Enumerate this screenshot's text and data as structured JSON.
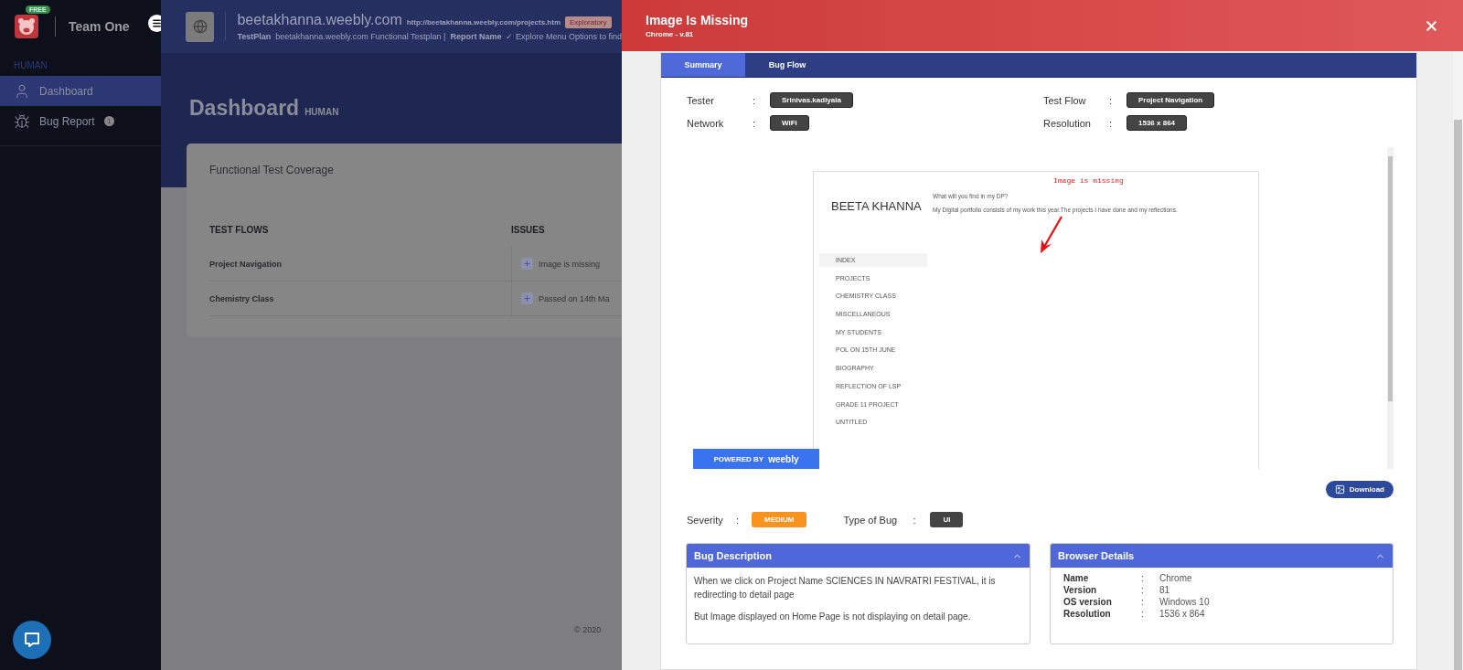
{
  "sidebar": {
    "brand": {
      "badge": "FREE",
      "name": "Team One"
    },
    "section": "HUMAN",
    "items": [
      {
        "label": "Dashboard",
        "selected": true
      },
      {
        "label": "Bug Report",
        "count": "1",
        "selected": false
      }
    ]
  },
  "project": {
    "name": "beetakhanna.weebly.com",
    "url": "http://beetakhanna.weebly.com/projects.htm",
    "tag": "Exploratory",
    "testplan_label": "TestPlan",
    "testplan": "beetakhanna.weebly.com Functional Testplan |",
    "report_label": "Report Name",
    "report": "✓ Explore Menu Options to find"
  },
  "page": {
    "title": "Dashboard",
    "subtitle": "HUMAN"
  },
  "coverage": {
    "title": "Functional Test Coverage",
    "columns": [
      "TEST FLOWS",
      "ISSUES"
    ],
    "rows": [
      {
        "flow": "Project Navigation",
        "issue": "Image is missing"
      },
      {
        "flow": "Chemistry Class",
        "issue": "Passed on 14th Ma"
      }
    ]
  },
  "footer": "© 2020",
  "modal": {
    "title": "Image Is Missing",
    "subtitle": "Chrome - v.81",
    "tabs": [
      {
        "label": "Summary",
        "selected": true
      },
      {
        "label": "Bug Flow",
        "selected": false
      }
    ],
    "details": [
      {
        "label": "Tester",
        "sep": ":",
        "value": "Srinivas.kadiyala"
      },
      {
        "label": "Test Flow",
        "sep": ":",
        "value": "Project Navigation"
      },
      {
        "label": "Network",
        "sep": ":",
        "value": "WiFi"
      },
      {
        "label": "Resolution",
        "sep": ":",
        "value": "1536 x 864"
      }
    ],
    "screenshot": {
      "site_title": "BEETA KHANNA",
      "heading": "What will you find in my DP?",
      "intro": "My Digital portfolio consists of my work this year.The  projects I have done and my reflections.",
      "annotation": "Image is missing",
      "nav": [
        {
          "label": "INDEX",
          "selected": true
        },
        {
          "label": "PROJECTS",
          "selected": false
        },
        {
          "label": "CHEMISTRY CLASS",
          "selected": false
        },
        {
          "label": "MISCELLANEOUS",
          "selected": false
        },
        {
          "label": "MY STUDENTS",
          "selected": false
        },
        {
          "label": "POL ON 15TH JUNE",
          "selected": false
        },
        {
          "label": "BIOGRAPHY",
          "selected": false
        },
        {
          "label": "REFLECTION OF LSP",
          "selected": false
        },
        {
          "label": "GRADE 11 PROJECT",
          "selected": false
        },
        {
          "label": "UNTITLED",
          "selected": false
        }
      ],
      "powered_by": "POWERED BY",
      "powered_brand": "weebly"
    },
    "download": "Download",
    "severity": {
      "label": "Severity",
      "sep": ":",
      "value": "MEDIUM",
      "color": "#f7931e"
    },
    "bug_type": {
      "label": "Type of Bug",
      "sep": ":",
      "value": "UI",
      "color": "#444444"
    },
    "description": {
      "title": "Bug Description",
      "paragraphs": [
        "When we click on Project Name SCIENCES IN NAVRATRI FESTIVAL, it is redirecting to detail page",
        "But Image displayed on Home Page is not displaying on detail page."
      ]
    },
    "browser": {
      "title": "Browser Details",
      "rows": [
        {
          "label": "Name",
          "sep": ":",
          "value": "Chrome"
        },
        {
          "label": "Version",
          "sep": ":",
          "value": "81"
        },
        {
          "label": "OS version",
          "sep": ":",
          "value": "Windows 10"
        },
        {
          "label": "Resolution",
          "sep": ":",
          "value": "1536 x 864"
        }
      ]
    }
  }
}
